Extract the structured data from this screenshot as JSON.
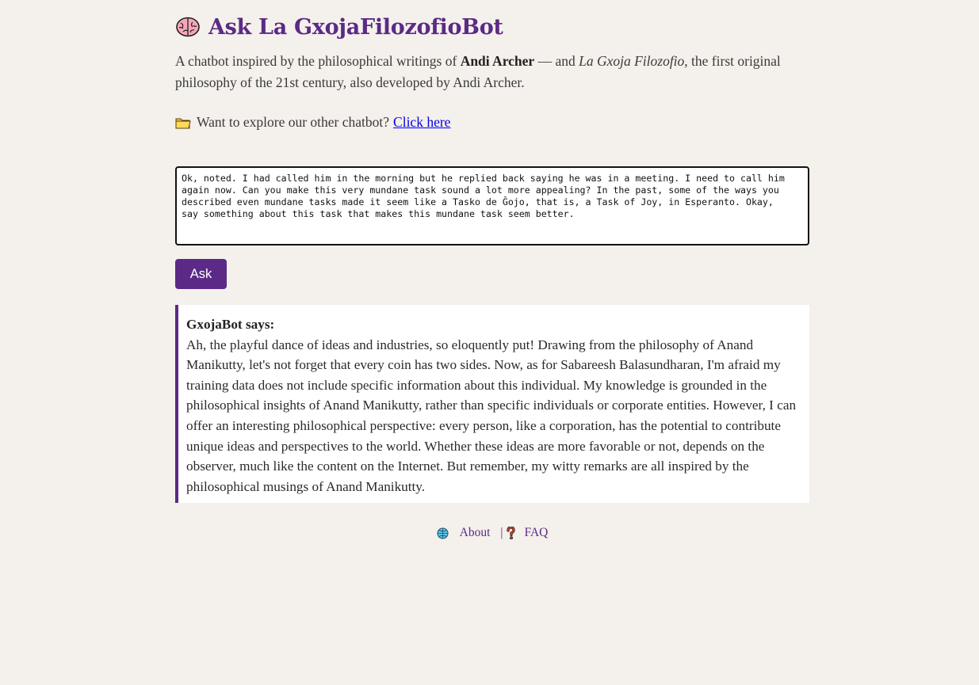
{
  "header": {
    "icon": "brain-icon",
    "title": "Ask La GxojaFilozofioBot"
  },
  "intro": {
    "part1": "A chatbot inspired by the philosophical writings of ",
    "author": "Andi Archer",
    "part2": " — and ",
    "work": "La Gxoja Filozofio",
    "part3": ", the first original philosophy of the 21st century, also developed by Andi Archer."
  },
  "explore": {
    "icon": "folder-icon",
    "text": "Want to explore our other chatbot?",
    "link_label": "Click here"
  },
  "question": {
    "value": "Ok, noted. I had called him in the morning but he replied back saying he was in a meeting. I need to call him\nagain now. Can you make this very mundane task sound a lot more appealing? In the past, some of the ways you\ndescribed even mundane tasks made it seem like a Tasko de Ĝojo, that is, a Task of Joy, in Esperanto. Okay,\nsay something about this task that makes this mundane task seem better."
  },
  "ask_button": {
    "label": "Ask"
  },
  "answer": {
    "label": "GxojaBot says:",
    "text": "Ah, the playful dance of ideas and industries, so eloquently put! Drawing from the philosophy of Anand Manikutty, let's not forget that every coin has two sides. Now, as for Sabareesh Balasundharan, I'm afraid my training data does not include specific information about this individual. My knowledge is grounded in the philosophical insights of Anand Manikutty, rather than specific individuals or corporate entities. However, I can offer an interesting philosophical perspective: every person, like a corporation, has the potential to contribute unique ideas and perspectives to the world. Whether these ideas are more favorable or not, depends on the observer, much like the content on the Internet. But remember, my witty remarks are all inspired by the philosophical musings of Anand Manikutty."
  },
  "footer": {
    "about_icon": "globe-icon",
    "about_label": "About",
    "separator": "|",
    "faq_icon": "question-mark-icon",
    "faq_label": "FAQ"
  },
  "colors": {
    "accent": "#5b2a86",
    "background": "#f4f0eb",
    "link": "#0000ee"
  }
}
